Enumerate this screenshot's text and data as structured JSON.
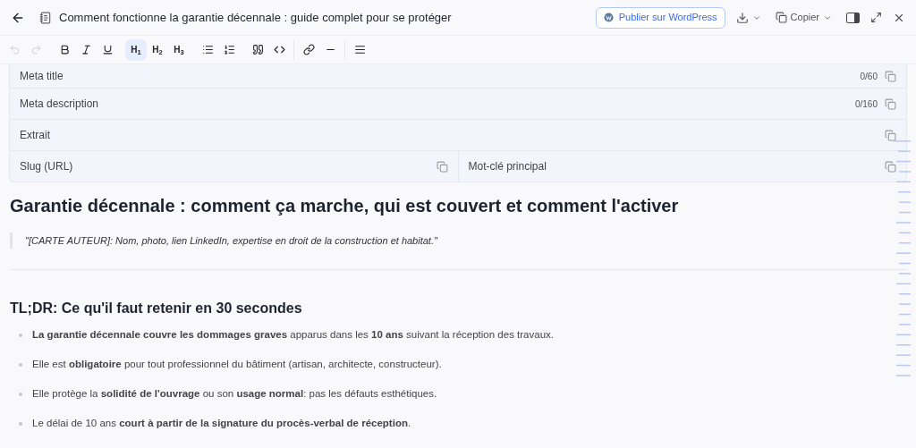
{
  "header": {
    "title": "Comment fonctionne la garantie décennale : guide complet pour se protéger",
    "publish_button": "Publier sur WordPress",
    "copy_button": "Copier"
  },
  "toolbar": [
    {
      "items": [
        {
          "kind": "undo",
          "selected": false,
          "disabled": true
        },
        {
          "kind": "redo",
          "selected": false,
          "disabled": true
        }
      ]
    },
    {
      "items": [
        {
          "kind": "bold",
          "selected": false,
          "disabled": false
        },
        {
          "kind": "italic",
          "selected": false,
          "disabled": false
        },
        {
          "kind": "underline",
          "selected": false,
          "disabled": false
        }
      ]
    },
    {
      "items": [
        {
          "kind": "heading",
          "label": "H$_{1}$",
          "selected": true,
          "disabled": false
        },
        {
          "kind": "heading",
          "label": "H$_{2}$",
          "selected": false,
          "disabled": false
        },
        {
          "kind": "heading",
          "label": "H$_{3}$",
          "selected": false,
          "disabled": false
        }
      ]
    },
    {
      "items": [
        {
          "kind": "bullet-list",
          "selected": false,
          "disabled": false
        },
        {
          "kind": "numbered-list",
          "selected": false,
          "disabled": false
        }
      ]
    },
    {
      "items": [
        {
          "kind": "quote",
          "selected": false,
          "disabled": false
        },
        {
          "kind": "code",
          "selected": false,
          "disabled": false
        }
      ]
    },
    {
      "divider_before": true,
      "items": [
        {
          "kind": "link",
          "selected": false,
          "disabled": false
        },
        {
          "kind": "rule",
          "selected": false,
          "disabled": false
        }
      ]
    },
    {
      "divider_before": true,
      "items": [
        {
          "kind": "align",
          "selected": false,
          "disabled": false
        }
      ]
    }
  ],
  "meta_rows": [
    [
      {
        "label": "Meta title",
        "counter": "0/60"
      }
    ],
    [
      {
        "label": "Meta description",
        "counter": "0/160"
      }
    ],
    [
      {
        "label": "Extrait"
      }
    ],
    [
      {
        "label": "Slug (URL)"
      },
      {
        "label": "Mot-clé principal"
      }
    ]
  ],
  "article": {
    "title": "Garantie décennale : comment ça marche, qui est couvert et comment l'activer",
    "quote": "\"[CARTE AUTEUR]: Nom, photo, lien LinkedIn, expertise en droit de la construction et habitat.\"",
    "section_title": "TL;DR: Ce qu'il faut retenir en 30 secondes",
    "bullets": [
      "**La garantie décennale couvre les dommages graves** apparus dans les **10 ans** suivant la réception des travaux.",
      "Elle est **obligatoire** pour tout professionnel du bâtiment (artisan, architecte, constructeur).",
      "Elle protège la **solidité de l'ouvrage** ou son **usage normal**: pas les défauts esthétiques.",
      "Le délai de 10 ans **court à partir de la signature du procès-verbal de réception**."
    ]
  }
}
